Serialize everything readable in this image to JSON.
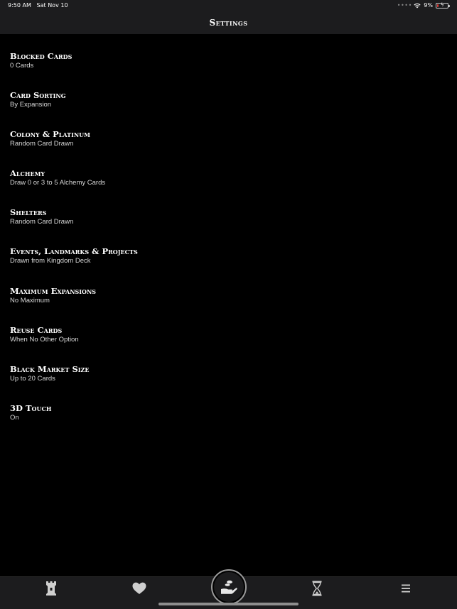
{
  "status_bar": {
    "time": "9:50 AM",
    "date": "Sat Nov 10",
    "battery_percent": "9%",
    "battery_level": 0.09,
    "battery_color": "#e53935"
  },
  "nav": {
    "title": "Settings"
  },
  "settings": [
    {
      "title": "Blocked Cards",
      "value": "0 Cards"
    },
    {
      "title": "Card Sorting",
      "value": "By Expansion"
    },
    {
      "title": "Colony & Platinum",
      "value": "Random Card Drawn"
    },
    {
      "title": "Alchemy",
      "value": "Draw 0 or 3 to 5 Alchemy Cards"
    },
    {
      "title": "Shelters",
      "value": "Random Card Drawn"
    },
    {
      "title": "Events, Landmarks & Projects",
      "value": "Drawn from Kingdom Deck"
    },
    {
      "title": "Maximum Expansions",
      "value": "No Maximum"
    },
    {
      "title": "Reuse Cards",
      "value": "When No Other Option"
    },
    {
      "title": "Black Market Size",
      "value": "Up to 20 Cards"
    },
    {
      "title": "3D Touch",
      "value": "On"
    }
  ],
  "tab_bar": {
    "tabs": [
      {
        "icon": "tower-icon"
      },
      {
        "icon": "heart-icon"
      },
      {
        "icon": "hand-coin-icon"
      },
      {
        "icon": "hourglass-icon"
      },
      {
        "icon": "menu-icon"
      }
    ]
  }
}
